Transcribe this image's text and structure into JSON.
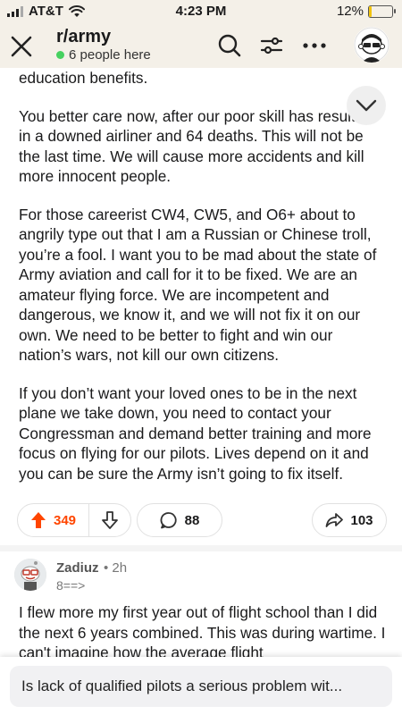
{
  "status_bar": {
    "carrier": "AT&T",
    "time": "4:23 PM",
    "battery_text": "12%",
    "battery_level": 0.12
  },
  "header": {
    "subreddit": "r/army",
    "online_text": "6 people here",
    "icons": [
      "close-icon",
      "search-icon",
      "filter-icon",
      "more-icon",
      "avatar"
    ]
  },
  "post": {
    "paragraphs": [
      "education benefits.",
      "You better care now, after our poor skill has resulted in a downed airliner and 64 deaths. This will not be the last time. We will cause more accidents and kill more innocent people.",
      "For those careerist CW4, CW5, and O6+ about to angrily type out that I am a Russian or Chinese troll, you’re a fool. I want you to be mad about the state of Army aviation and call for it to be fixed. We are an amateur flying force. We are incompetent and dangerous, we know it, and we will not fix it on our own. We need to be better to fight and win our nation’s wars, not kill our own citizens.",
      "If you don’t want your loved ones to be in the next plane we take down, you need to contact your Congressman and demand better training and more focus on flying for our pilots. Lives depend on it and you can be sure the Army isn’t going to fix itself."
    ],
    "upvotes": "349",
    "comments": "88",
    "shares": "103"
  },
  "comment": {
    "author": "Zadiuz",
    "time": "• 2h",
    "flair": "8==>",
    "body": "I flew more my first year out of flight school than I did the next 6 years combined. This was during wartime. I can't imagine how the average flight"
  },
  "input": {
    "placeholder": "Is lack of qualified pilots a serious problem wit..."
  },
  "colors": {
    "accent_upvote": "#ff4500",
    "online": "#46d160",
    "header_bg": "#f4f0e8",
    "battery": "#f2c40f"
  }
}
